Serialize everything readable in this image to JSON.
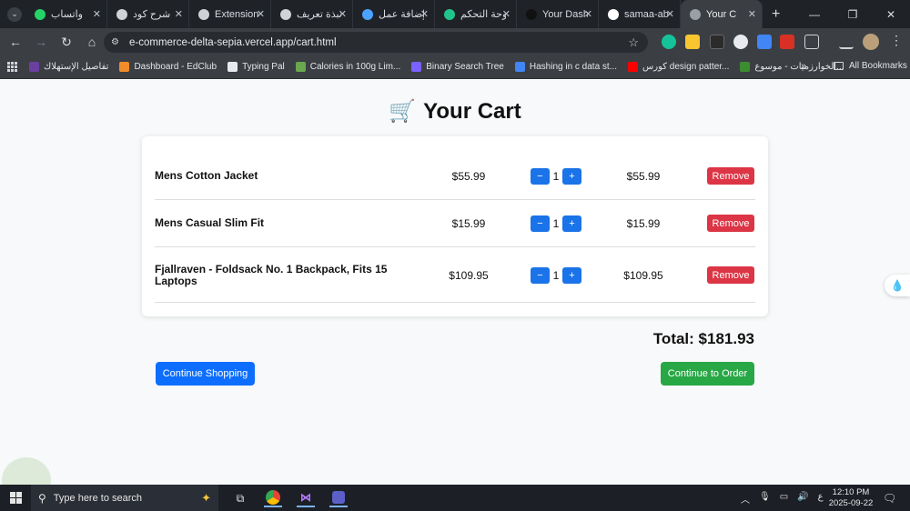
{
  "browser": {
    "tabs": [
      {
        "title": "واتساب",
        "color": "#25d366"
      },
      {
        "title": "شرح كود",
        "color": "#cfd3d8"
      },
      {
        "title": "Extension",
        "color": "#cfd3d8"
      },
      {
        "title": "نبذة تعريف",
        "color": "#cfd3d8"
      },
      {
        "title": "إضافة عمل",
        "color": "#4aa3ff"
      },
      {
        "title": "لوحة التحكم",
        "color": "#21c48a"
      },
      {
        "title": "Your Dash",
        "color": "#111111"
      },
      {
        "title": "samaa-ab",
        "color": "#ffffff"
      },
      {
        "title": "Your C",
        "color": "#9aa0a6"
      }
    ],
    "new_tab": "+",
    "url": "e-commerce-delta-sepia.vercel.app/cart.html",
    "bookmarks": [
      {
        "label": "تفاصيل الإستهلاك",
        "color": "#6b3fa0"
      },
      {
        "label": "Dashboard - EdClub",
        "color": "#f28c28"
      },
      {
        "label": "Typing Pal",
        "color": "#e8eaed"
      },
      {
        "label": "Calories in 100g Lim...",
        "color": "#6aa84f"
      },
      {
        "label": "Binary Search Tree",
        "color": "#7b61ff"
      },
      {
        "label": "Hashing in c data st...",
        "color": "#4285f4"
      },
      {
        "label": "كورس design patter...",
        "color": "#ff0000"
      },
      {
        "label": "الخوارزميات - موسوع...",
        "color": "#3c8d2f"
      }
    ],
    "all_bookmarks": "All Bookmarks",
    "more": "»"
  },
  "page": {
    "title": "Your Cart",
    "cart_icon": "🛒",
    "items": [
      {
        "name": "Mens Cotton Jacket",
        "price": "$55.99",
        "qty": "1",
        "subtotal": "$55.99"
      },
      {
        "name": "Mens Casual Slim Fit",
        "price": "$15.99",
        "qty": "1",
        "subtotal": "$15.99"
      },
      {
        "name": "Fjallraven - Foldsack No. 1 Backpack, Fits 15 Laptops",
        "price": "$109.95",
        "qty": "1",
        "subtotal": "$109.95"
      }
    ],
    "minus_label": "−",
    "plus_label": "+",
    "remove_label": "Remove",
    "total": "Total: $181.93",
    "continue_shopping": "Continue Shopping",
    "continue_order": "Continue to Order",
    "accent": "#0d6efd",
    "danger": "#dc3545",
    "success": "#28a745"
  },
  "taskbar": {
    "search_placeholder": "Type here to search",
    "lang": "ع",
    "time": "12:10 PM",
    "date": "2025-09-22"
  }
}
